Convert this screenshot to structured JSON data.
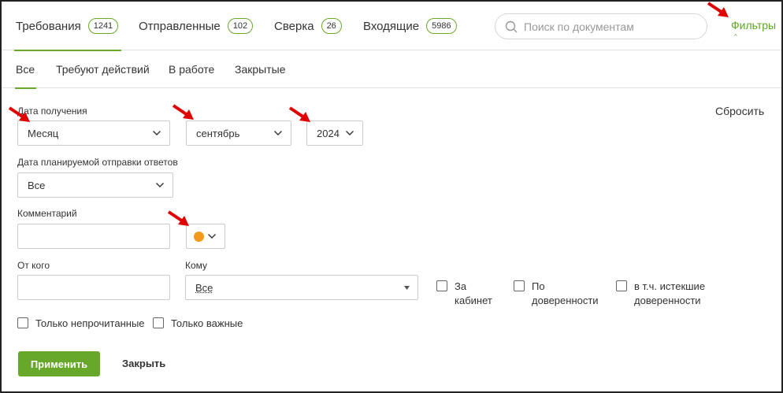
{
  "top_tabs": [
    {
      "label": "Требования",
      "count": "1241"
    },
    {
      "label": "Отправленные",
      "count": "102"
    },
    {
      "label": "Сверка",
      "count": "26"
    },
    {
      "label": "Входящие",
      "count": "5986"
    }
  ],
  "search": {
    "placeholder": "Поиск по документам"
  },
  "filters_label": "Фильтры",
  "filters_caret": "^",
  "sub_tabs": [
    "Все",
    "Требуют действий",
    "В работе",
    "Закрытые"
  ],
  "filters": {
    "receipt_date_label": "Дата получения",
    "period_value": "Месяц",
    "month_value": "сентябрь",
    "year_value": "2024",
    "reset_label": "Сбросить",
    "planned_reply_label": "Дата планируемой отправки ответов",
    "planned_reply_value": "Все",
    "comment_label": "Комментарий",
    "comment_value": "",
    "color_value": "#f39a1b",
    "from_label": "От кого",
    "from_value": "",
    "to_label": "Кому",
    "to_value": "Все",
    "cb_cabinet_line1": "За",
    "cb_cabinet_line2": "кабинет",
    "cb_proxy_line1": "По",
    "cb_proxy_line2": "доверенности",
    "cb_expired_line1": "в т.ч. истекшие",
    "cb_expired_line2": "доверенности",
    "cb_unread": "Только непрочитанные",
    "cb_important": "Только важные"
  },
  "actions": {
    "apply": "Применить",
    "close": "Закрыть"
  },
  "colors": {
    "accent": "#67a72a",
    "annotation_arrow": "#e00000"
  }
}
